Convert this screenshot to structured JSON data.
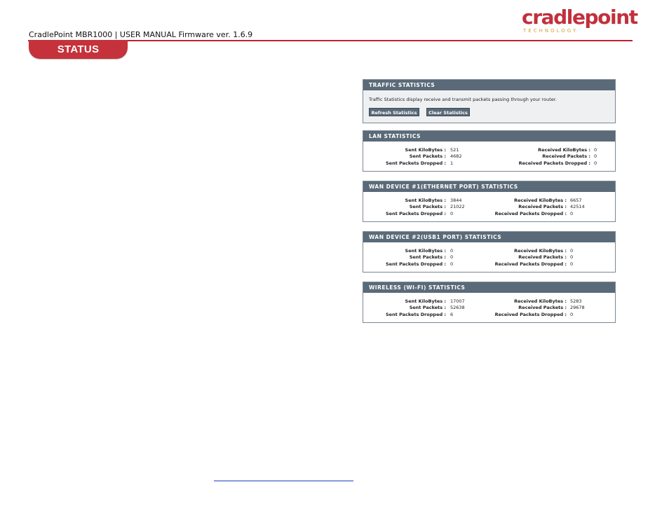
{
  "header": {
    "doc_title": "CradlePoint MBR1000 | USER MANUAL Firmware ver. 1.6.9",
    "logo_word": "cradlepoint",
    "logo_sub": "TECHNOLOGY",
    "section_tab": "STATUS"
  },
  "traffic": {
    "title": "TRAFFIC STATISTICS",
    "description": "Traffic Statistics display receive and transmit packets passing through your router.",
    "refresh_label": "Refresh Statistics",
    "clear_label": "Clear Statistics"
  },
  "lan": {
    "title": "LAN STATISTICS",
    "left": [
      {
        "label": "Sent KiloBytes :",
        "value": "521"
      },
      {
        "label": "Sent Packets :",
        "value": "4682"
      },
      {
        "label": "Sent Packets Dropped :",
        "value": "1"
      }
    ],
    "right": [
      {
        "label": "Received KiloBytes :",
        "value": "0"
      },
      {
        "label": "Received Packets :",
        "value": "0"
      },
      {
        "label": "Received Packets Dropped :",
        "value": "0"
      }
    ]
  },
  "wan1": {
    "title": "WAN DEVICE #1(ETHERNET PORT) STATISTICS",
    "left": [
      {
        "label": "Sent KiloBytes :",
        "value": "3844"
      },
      {
        "label": "Sent Packets :",
        "value": "21022"
      },
      {
        "label": "Sent Packets Dropped :",
        "value": "0"
      }
    ],
    "right": [
      {
        "label": "Received KiloBytes :",
        "value": "6657"
      },
      {
        "label": "Received Packets :",
        "value": "42514"
      },
      {
        "label": "Received Packets Dropped :",
        "value": "0"
      }
    ]
  },
  "wan2": {
    "title": "WAN DEVICE #2(USB1 PORT) STATISTICS",
    "left": [
      {
        "label": "Sent KiloBytes :",
        "value": "0"
      },
      {
        "label": "Sent Packets :",
        "value": "0"
      },
      {
        "label": "Sent Packets Dropped :",
        "value": "0"
      }
    ],
    "right": [
      {
        "label": "Received KiloBytes :",
        "value": "0"
      },
      {
        "label": "Received Packets :",
        "value": "0"
      },
      {
        "label": "Received Packets Dropped :",
        "value": "0"
      }
    ]
  },
  "wifi": {
    "title": "WIRELESS (WI-FI) STATISTICS",
    "left": [
      {
        "label": "Sent KiloBytes :",
        "value": "17007"
      },
      {
        "label": "Sent Packets :",
        "value": "52638"
      },
      {
        "label": "Sent Packets Dropped :",
        "value": "6"
      }
    ],
    "right": [
      {
        "label": "Received KiloBytes :",
        "value": "5283"
      },
      {
        "label": "Received Packets :",
        "value": "29678"
      },
      {
        "label": "Received Packets Dropped :",
        "value": "0"
      }
    ]
  },
  "colors": {
    "brand_red": "#c5323b",
    "panel_header": "#5b6a78",
    "logo_gold": "#c9a33a"
  }
}
